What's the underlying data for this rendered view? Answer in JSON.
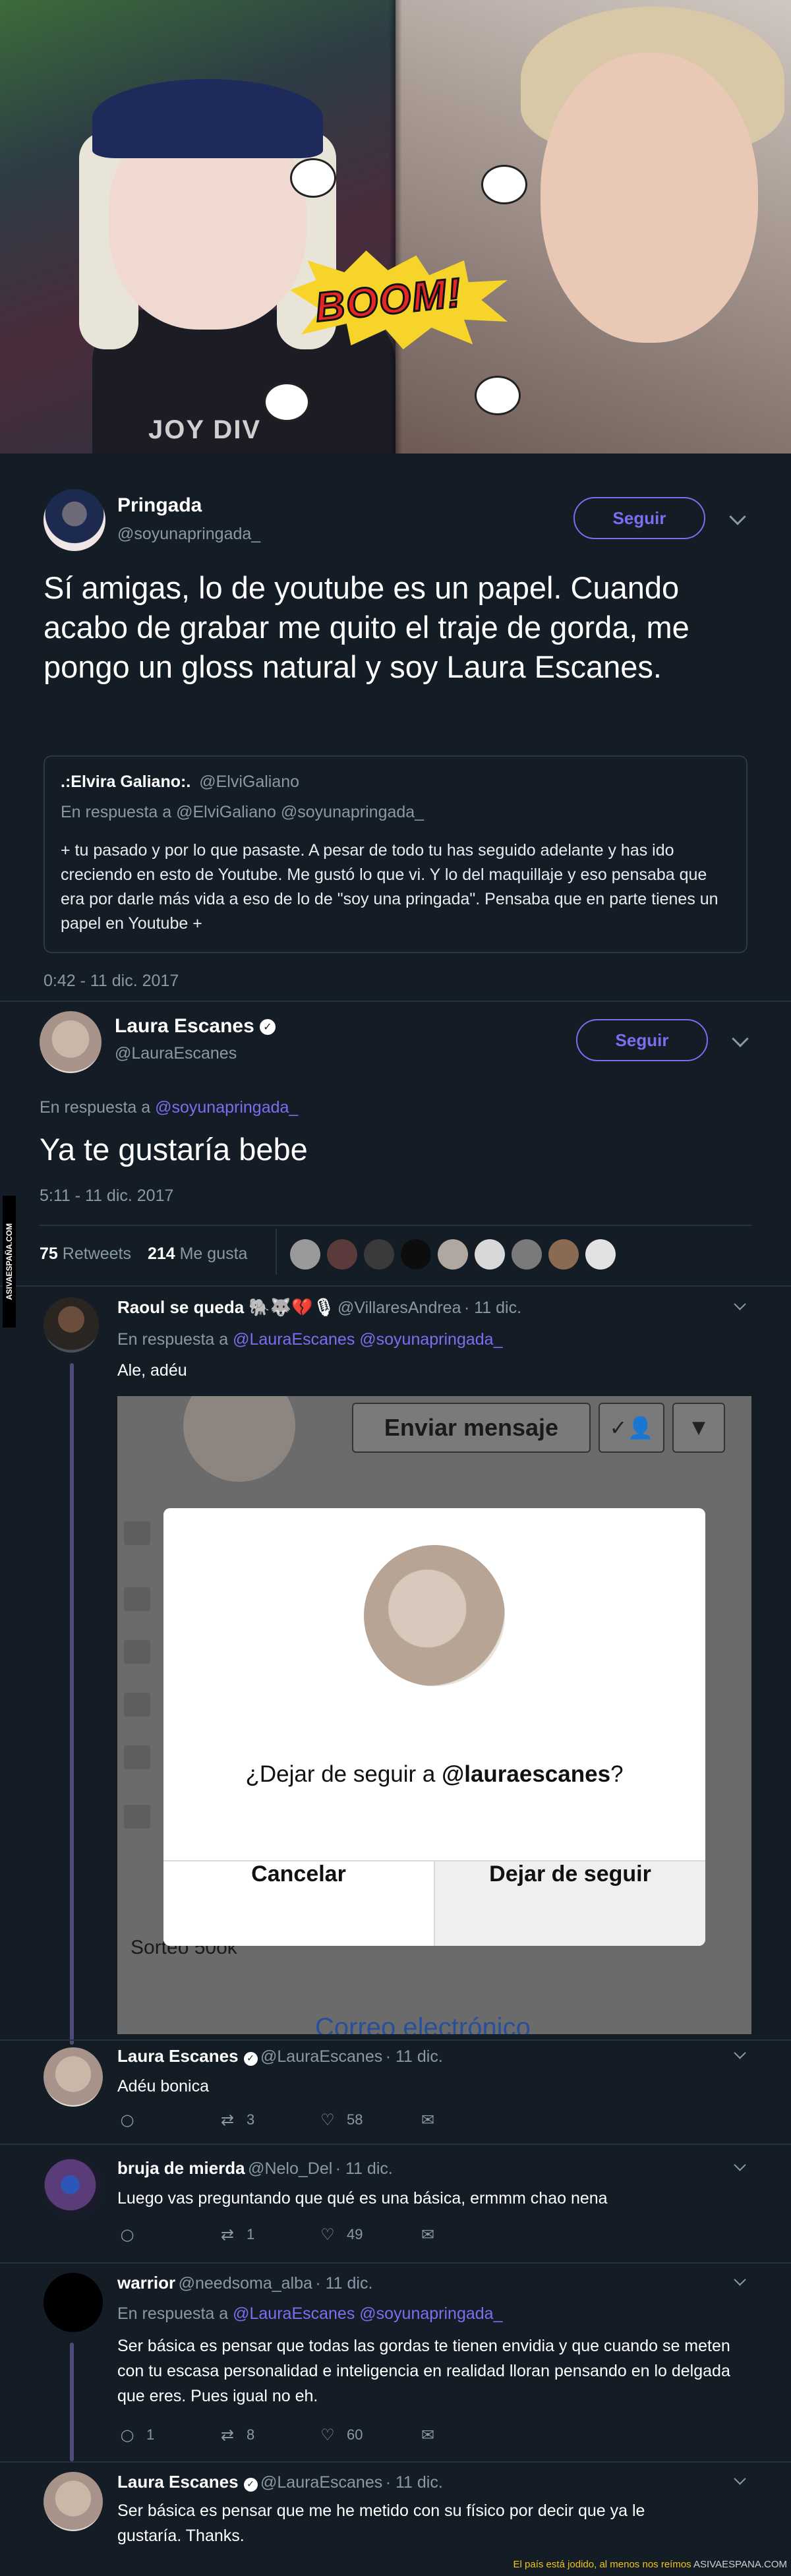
{
  "header_image": {
    "shirt_text": "JOY DIV",
    "boom_text": "BOOM!"
  },
  "main_tweet": {
    "name": "Pringada",
    "handle": "@soyunapringada_",
    "follow_label": "Seguir",
    "text": "Sí amigas, lo de youtube es un papel. Cuando acabo de grabar me quito el traje de gorda, me pongo un gloss natural y soy Laura Escanes.",
    "quoted": {
      "name": ".:Elvira Galiano:.",
      "handle": "@ElviGaliano",
      "reply_label": "En respuesta a @ElviGaliano @soyunapringada_",
      "text": "+ tu pasado y por lo que pasaste. A pesar de todo tu has seguido adelante y has ido creciendo en esto de Youtube. Me gustó lo que vi. Y lo del maquillaje y eso pensaba que era por darle más vida a eso de lo de \"soy una pringada\". Pensaba que en parte tienes un papel en Youtube +"
    },
    "timestamp": "0:42 - 11 dic. 2017"
  },
  "reply_tweet": {
    "name": "Laura Escanes",
    "handle": "@LauraEscanes",
    "follow_label": "Seguir",
    "reply_prefix": "En respuesta a",
    "reply_to": "@soyunapringada_",
    "text": "Ya te gustaría bebe",
    "timestamp": "5:11 - 11 dic. 2017",
    "retweets_count": "75",
    "retweets_label": "Retweets",
    "likes_count": "214",
    "likes_label": "Me gusta"
  },
  "replies": [
    {
      "name": "Raoul se queda 🐘🐺💔🎙",
      "handle": "@VillaresAndrea",
      "time": "· 11 dic.",
      "reply_prefix": "En respuesta a",
      "reply_to": "@LauraEscanes @soyunapringada_",
      "text": "Ale, adéu",
      "screenshot": {
        "send_message": "Enviar mensaje",
        "question_prefix": "¿Dejar de seguir a ",
        "question_user": "@lauraescanes",
        "question_suffix": "?",
        "cancel": "Cancelar",
        "unfollow": "Dejar de seguir",
        "sorteo": "Sorteo 50ok",
        "email": "Correo electrónico"
      }
    },
    {
      "name": "Laura Escanes",
      "handle": "@LauraEscanes",
      "time": "· 11 dic.",
      "text": "Adéu bonica",
      "retweets": "3",
      "likes": "58"
    },
    {
      "name": "bruja de mierda",
      "handle": "@Nelo_Del",
      "time": "· 11 dic.",
      "text": "Luego vas preguntando que qué es una básica, ermmm chao nena",
      "retweets": "1",
      "likes": "49"
    },
    {
      "name": "warrior",
      "handle": "@needsoma_alba",
      "time": "· 11 dic.",
      "reply_prefix": "En respuesta a",
      "reply_to": "@LauraEscanes @soyunapringada_",
      "text": "Ser básica es pensar que todas las gordas te tienen envidia y que cuando se meten con tu escasa personalidad e inteligencia en realidad lloran pensando en lo delgada que eres. Pues igual no eh.",
      "replies": "1",
      "retweets": "8",
      "likes": "60"
    },
    {
      "name": "Laura Escanes",
      "handle": "@LauraEscanes",
      "time": "· 11 dic.",
      "text": "Ser básica es pensar que me he metido con su físico por decir que ya le gustaría. Thanks."
    }
  ],
  "watermarks": {
    "side": "ASIVAESPAÑA.COM",
    "footer_text": "El país está jodido, al menos nos reímos",
    "footer_brand": "ASIVAESPANA.COM"
  },
  "colors": {
    "background": "#141d26",
    "accent": "#7b6ef0",
    "muted": "#8899a6"
  }
}
